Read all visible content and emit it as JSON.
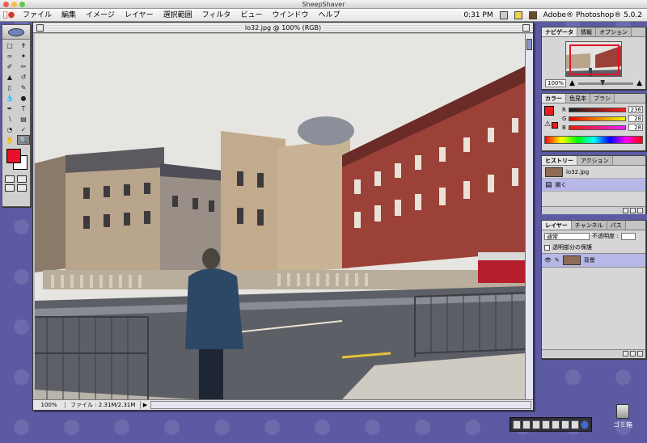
{
  "titlebar": {
    "title": "SheepShaver"
  },
  "menubar": {
    "apple_icon": "apple-icon",
    "items": [
      "ファイル",
      "編集",
      "イメージ",
      "レイヤー",
      "選択範囲",
      "フィルタ",
      "ビュー",
      "ウインドウ",
      "ヘルプ"
    ],
    "clock": "0:31 PM",
    "app_name": "Adobe® Photoshop® 5.0.2"
  },
  "document": {
    "title": "lo32.jpg @ 100% (RGB)",
    "zoom": "100%",
    "file_size": "ファイル : 2.31M/2.31M"
  },
  "navigator": {
    "tabs": [
      "ナビゲータ",
      "情報",
      "オプション"
    ],
    "zoom": "100%"
  },
  "color": {
    "tabs": [
      "カラー",
      "色見本",
      "ブラシ"
    ],
    "r_label": "R",
    "r_value": "236",
    "g_label": "G",
    "g_value": "28",
    "b_label": "B",
    "b_value": "28",
    "foreground": "#ec1c1c"
  },
  "history": {
    "tabs": [
      "ヒストリー",
      "アクション"
    ],
    "items": [
      {
        "label": "lo32.jpg"
      },
      {
        "label": "開く"
      }
    ]
  },
  "layers": {
    "tabs": [
      "レイヤー",
      "チャンネル",
      "パス"
    ],
    "blend_mode": "通常",
    "opacity_label": "不透明度 :",
    "preserve_label": "透明部分の保護",
    "layer_name": "背景"
  },
  "desktop": {
    "trash_label": "ゴミ箱"
  }
}
